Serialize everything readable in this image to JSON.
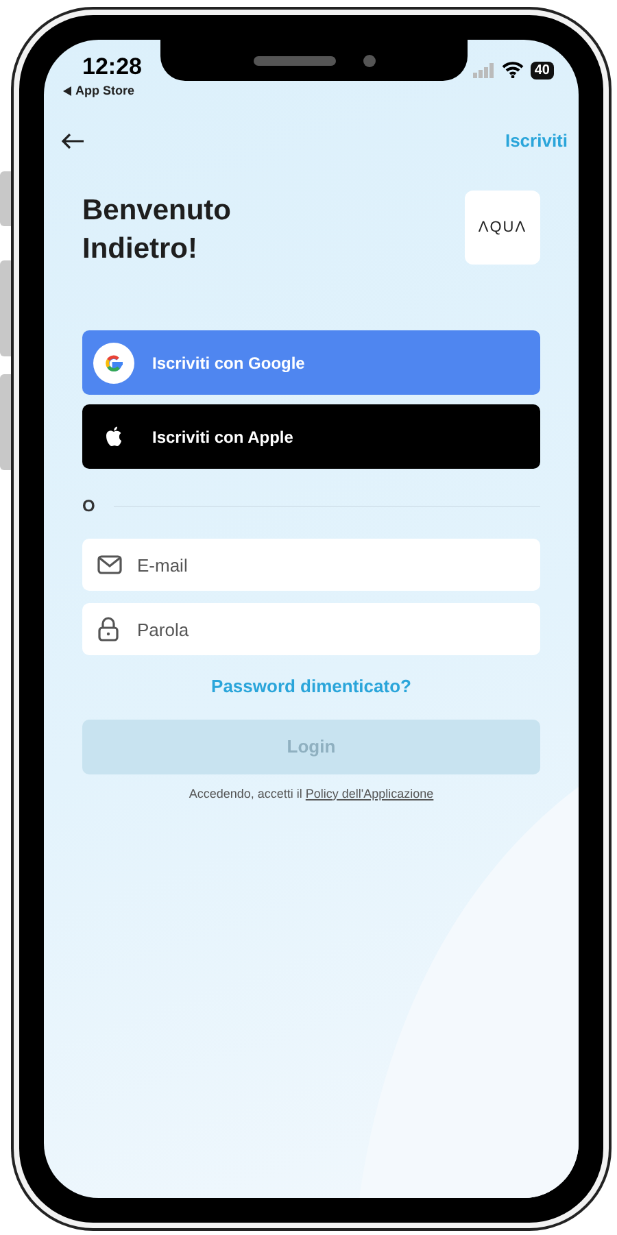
{
  "status_bar": {
    "time": "12:28",
    "back_app": "App Store",
    "battery": "40"
  },
  "nav": {
    "action": "Iscriviti"
  },
  "title": "Benvenuto Indietro!",
  "logo": {
    "text": "ΛQUΛ"
  },
  "social_buttons": [
    {
      "kind": "google",
      "label": "Iscriviti con Google"
    },
    {
      "kind": "apple",
      "label": "Iscriviti con Apple"
    }
  ],
  "divider": "O",
  "fields": [
    {
      "kind": "email",
      "placeholder": "E-mail"
    },
    {
      "kind": "password",
      "placeholder": "Parola"
    }
  ],
  "forgot_link": "Password dimenticato?",
  "login_button": {
    "label": "Login",
    "disabled": true
  },
  "terms": {
    "text": "Accedendo, accetti il",
    "link": "Policy dell'Applicazione"
  }
}
